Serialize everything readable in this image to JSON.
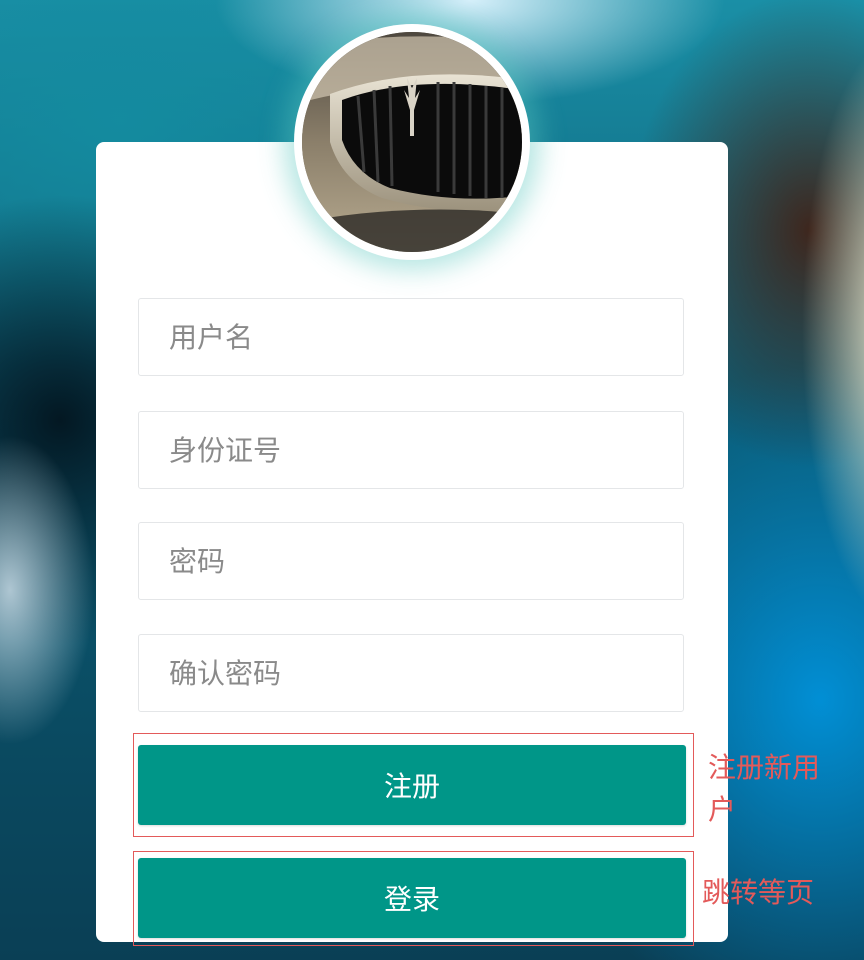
{
  "form": {
    "username_placeholder": "用户名",
    "idcard_placeholder": "身份证号",
    "password_placeholder": "密码",
    "confirm_password_placeholder": "确认密码"
  },
  "buttons": {
    "register_label": "注册",
    "login_label": "登录"
  },
  "annotations": {
    "register_note": "注册新用户",
    "login_note": "跳转等页"
  },
  "colors": {
    "accent": "#009688",
    "annotation": "#e35a5a"
  },
  "icons": {
    "avatar": "car-grille-avatar"
  }
}
